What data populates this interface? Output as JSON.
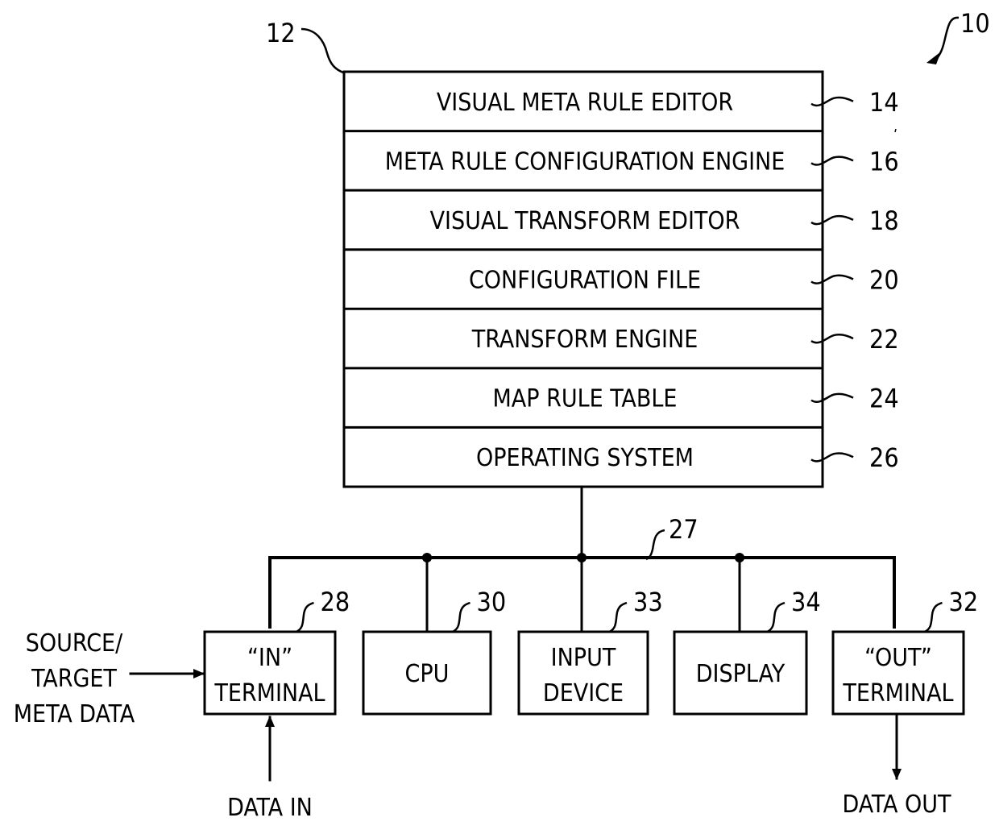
{
  "figure": {
    "system_ref": "10",
    "stack": {
      "ref": "12",
      "layers": [
        {
          "label": "VISUAL META RULE EDITOR",
          "ref": "14"
        },
        {
          "label": "META RULE CONFIGURATION ENGINE",
          "ref": "16"
        },
        {
          "label": "VISUAL TRANSFORM EDITOR",
          "ref": "18"
        },
        {
          "label": "CONFIGURATION FILE",
          "ref": "20"
        },
        {
          "label": "TRANSFORM ENGINE",
          "ref": "22"
        },
        {
          "label": "MAP RULE TABLE",
          "ref": "24"
        },
        {
          "label": "OPERATING SYSTEM",
          "ref": "26"
        }
      ]
    },
    "bus": {
      "ref": "27"
    },
    "devices": [
      {
        "line1": "“IN”",
        "line2": "TERMINAL",
        "ref": "28"
      },
      {
        "line1": "CPU",
        "line2": "",
        "ref": "30"
      },
      {
        "line1": "INPUT",
        "line2": "DEVICE",
        "ref": "33"
      },
      {
        "line1": "DISPLAY",
        "line2": "",
        "ref": "34"
      },
      {
        "line1": "“OUT”",
        "line2": "TERMINAL",
        "ref": "32"
      }
    ],
    "inputs": {
      "meta_data": [
        "SOURCE/",
        "TARGET",
        "META DATA"
      ],
      "data_in": "DATA IN",
      "data_out": "DATA OUT"
    }
  }
}
